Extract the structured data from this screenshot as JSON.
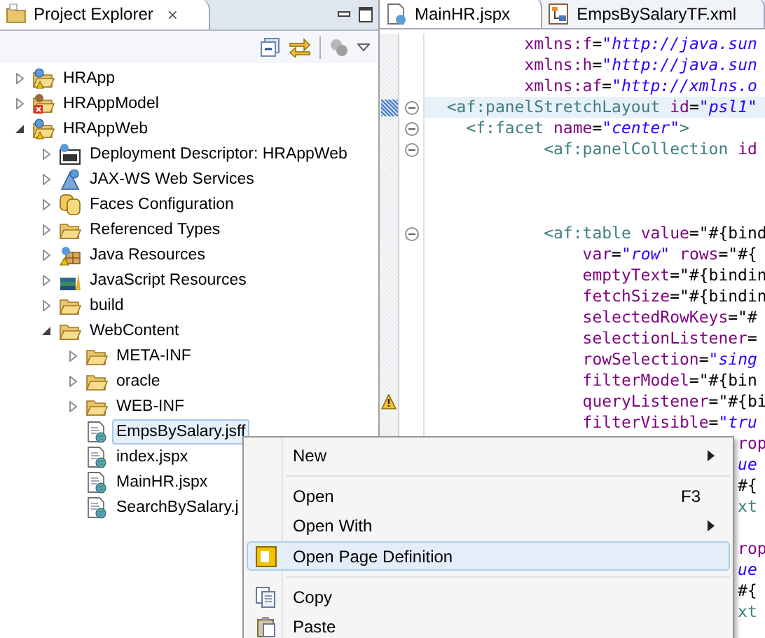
{
  "explorer": {
    "title": "Project Explorer",
    "close": "×",
    "tree": [
      {
        "label": "HRApp",
        "kind": "project",
        "expanded": false,
        "selected": false
      },
      {
        "label": "HRAppModel",
        "kind": "project-error",
        "expanded": false,
        "selected": false
      },
      {
        "label": "HRAppWeb",
        "kind": "project",
        "expanded": true,
        "selected": false,
        "children": [
          {
            "label": "Deployment Descriptor: HRAppWeb",
            "kind": "descriptor",
            "expanded": false,
            "selected": false
          },
          {
            "label": "JAX-WS Web Services",
            "kind": "webservice",
            "expanded": false,
            "selected": false
          },
          {
            "label": "Faces Configuration",
            "kind": "faces",
            "expanded": false,
            "selected": false
          },
          {
            "label": "Referenced Types",
            "kind": "folder",
            "expanded": false,
            "selected": false
          },
          {
            "label": "Java Resources",
            "kind": "java",
            "expanded": false,
            "selected": false
          },
          {
            "label": "JavaScript Resources",
            "kind": "js",
            "expanded": false,
            "selected": false
          },
          {
            "label": "build",
            "kind": "folder",
            "expanded": false,
            "selected": false
          },
          {
            "label": "WebContent",
            "kind": "folder",
            "expanded": true,
            "selected": false,
            "children": [
              {
                "label": "META-INF",
                "kind": "folder",
                "expanded": false,
                "selected": false
              },
              {
                "label": "oracle",
                "kind": "folder",
                "expanded": false,
                "selected": false
              },
              {
                "label": "WEB-INF",
                "kind": "folder",
                "expanded": false,
                "selected": false
              },
              {
                "label": "EmpsBySalary.jsff",
                "kind": "file",
                "selected": true
              },
              {
                "label": "index.jspx",
                "kind": "file",
                "selected": false
              },
              {
                "label": "MainHR.jspx",
                "kind": "file",
                "selected": false
              },
              {
                "label": "SearchBySalary.j",
                "kind": "file",
                "selected": false
              }
            ]
          }
        ]
      }
    ]
  },
  "editor": {
    "tabs": [
      {
        "label": "MainHR.jspx",
        "kind": "page",
        "selected": true
      },
      {
        "label": "EmpsBySalaryTF.xml",
        "kind": "flow",
        "selected": false
      }
    ],
    "lines": [
      {
        "kind": "code",
        "current": false,
        "segments": [
          {
            "kind": "attr",
            "text": "xmlns:f"
          },
          {
            "kind": "plain",
            "text": "="
          },
          {
            "kind": "value",
            "text": "\"http://java.sun"
          }
        ]
      },
      {
        "kind": "code",
        "current": false,
        "segments": [
          {
            "kind": "attr",
            "text": "xmlns:h"
          },
          {
            "kind": "plain",
            "text": "="
          },
          {
            "kind": "value",
            "text": "\"http://java.sun"
          }
        ]
      },
      {
        "kind": "code",
        "current": false,
        "segments": [
          {
            "kind": "attr",
            "text": "xmlns:af"
          },
          {
            "kind": "plain",
            "text": "="
          },
          {
            "kind": "value",
            "text": "\"http://xmlns.o"
          }
        ]
      },
      {
        "kind": "fold",
        "current": true,
        "segments": [
          {
            "kind": "tag",
            "text": "<af:panelStretchLayout "
          },
          {
            "kind": "attr",
            "text": "id"
          },
          {
            "kind": "plain",
            "text": "="
          },
          {
            "kind": "value",
            "text": "\"psl1\""
          }
        ]
      },
      {
        "kind": "fold",
        "current": false,
        "segments": [
          {
            "kind": "tag",
            "text": "<f:facet "
          },
          {
            "kind": "attr",
            "text": "name"
          },
          {
            "kind": "plain",
            "text": "="
          },
          {
            "kind": "value",
            "text": "\"center\""
          },
          {
            "kind": "tag",
            "text": ">"
          }
        ]
      },
      {
        "kind": "fold",
        "current": false,
        "segments": [
          {
            "kind": "tag",
            "text": "<af:panelCollection "
          },
          {
            "kind": "attr",
            "text": "id"
          }
        ]
      },
      {
        "kind": "code",
        "current": false
      },
      {
        "kind": "code",
        "current": false
      },
      {
        "kind": "code",
        "current": false
      },
      {
        "kind": "fold",
        "current": false,
        "segments": [
          {
            "kind": "tag",
            "text": "<af:table "
          },
          {
            "kind": "attr",
            "text": "value"
          },
          {
            "kind": "plain",
            "text": "=\"#{bind"
          }
        ]
      },
      {
        "kind": "code",
        "current": false,
        "segments": [
          {
            "kind": "attr",
            "text": "var"
          },
          {
            "kind": "plain",
            "text": "="
          },
          {
            "kind": "value",
            "text": "\"row\" "
          },
          {
            "kind": "attr",
            "text": "rows"
          },
          {
            "kind": "plain",
            "text": "=\"#{"
          }
        ]
      },
      {
        "kind": "code",
        "current": false,
        "segments": [
          {
            "kind": "attr",
            "text": "emptyText"
          },
          {
            "kind": "plain",
            "text": "=\"#{bindin"
          }
        ]
      },
      {
        "kind": "code",
        "current": false,
        "segments": [
          {
            "kind": "attr",
            "text": "fetchSize"
          },
          {
            "kind": "plain",
            "text": "=\"#{bindin"
          }
        ]
      },
      {
        "kind": "code",
        "current": false,
        "segments": [
          {
            "kind": "attr",
            "text": "selectedRowKeys"
          },
          {
            "kind": "plain",
            "text": "=\"#"
          }
        ]
      },
      {
        "kind": "code",
        "current": false,
        "segments": [
          {
            "kind": "attr",
            "text": "selectionListener"
          },
          {
            "kind": "plain",
            "text": "="
          }
        ]
      },
      {
        "kind": "code",
        "current": false,
        "segments": [
          {
            "kind": "attr",
            "text": "rowSelection"
          },
          {
            "kind": "plain",
            "text": "="
          },
          {
            "kind": "value",
            "text": "\"sing"
          }
        ]
      },
      {
        "kind": "code",
        "current": false,
        "segments": [
          {
            "kind": "attr",
            "text": "filterModel"
          },
          {
            "kind": "plain",
            "text": "=\"#{bin"
          }
        ]
      },
      {
        "kind": "warning",
        "current": false,
        "segments": [
          {
            "kind": "attr",
            "text": "queryListener"
          },
          {
            "kind": "plain",
            "text": "=\"#{bi"
          }
        ]
      },
      {
        "kind": "code",
        "current": false,
        "segments": [
          {
            "kind": "attr",
            "text": "filterVisible"
          },
          {
            "kind": "plain",
            "text": "="
          },
          {
            "kind": "value",
            "text": "\"tru"
          }
        ]
      },
      {
        "kind": "code",
        "current": false,
        "segments": [
          {
            "kind": "attr",
            "text": "rop"
          }
        ]
      },
      {
        "kind": "code",
        "current": false,
        "segments": [
          {
            "kind": "value",
            "text": "ue"
          }
        ]
      },
      {
        "kind": "code",
        "current": false,
        "segments": [
          {
            "kind": "plain",
            "text": "#{"
          }
        ]
      },
      {
        "kind": "code",
        "current": false,
        "segments": [
          {
            "kind": "tag",
            "text": "xt"
          }
        ]
      },
      {
        "kind": "code",
        "current": false
      },
      {
        "kind": "code",
        "current": false,
        "segments": [
          {
            "kind": "attr",
            "text": "rop"
          }
        ]
      },
      {
        "kind": "code",
        "current": false,
        "segments": [
          {
            "kind": "value",
            "text": "ue"
          }
        ]
      },
      {
        "kind": "code",
        "current": false,
        "segments": [
          {
            "kind": "plain",
            "text": "#{"
          }
        ]
      },
      {
        "kind": "code",
        "current": false,
        "segments": [
          {
            "kind": "tag",
            "text": "xt"
          }
        ]
      }
    ]
  },
  "context_menu": {
    "items": [
      {
        "kind": "item",
        "label": "New",
        "submenu": true,
        "selected": false
      },
      {
        "kind": "separator"
      },
      {
        "kind": "item",
        "label": "Open",
        "shortcut": "F3",
        "submenu": false,
        "selected": false
      },
      {
        "kind": "item",
        "label": "Open With",
        "submenu": true,
        "selected": false
      },
      {
        "kind": "pagedef",
        "label": "Open Page Definition",
        "submenu": false,
        "selected": true
      },
      {
        "kind": "separator"
      },
      {
        "kind": "copy",
        "label": "Copy",
        "submenu": false,
        "selected": false
      },
      {
        "kind": "paste",
        "label": "Paste",
        "submenu": false,
        "selected": false
      }
    ]
  }
}
